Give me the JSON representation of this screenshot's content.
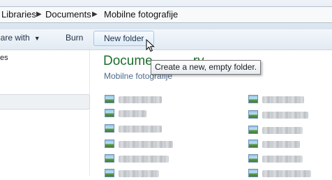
{
  "address": {
    "crumbs": [
      "Libraries",
      "Documents",
      "Mobilne fotografije"
    ]
  },
  "toolbar": {
    "share_label": "hare with",
    "burn_label": "Burn",
    "new_folder_label": "New folder"
  },
  "navpane": {
    "partial_text": "es"
  },
  "library": {
    "title": "Docume",
    "title_tail": "ry",
    "subtitle": "Mobilne fotografije"
  },
  "tooltip": {
    "text": "Create a new, empty folder."
  },
  "files": {
    "left_column_count": 7,
    "right_column_count": 6
  }
}
